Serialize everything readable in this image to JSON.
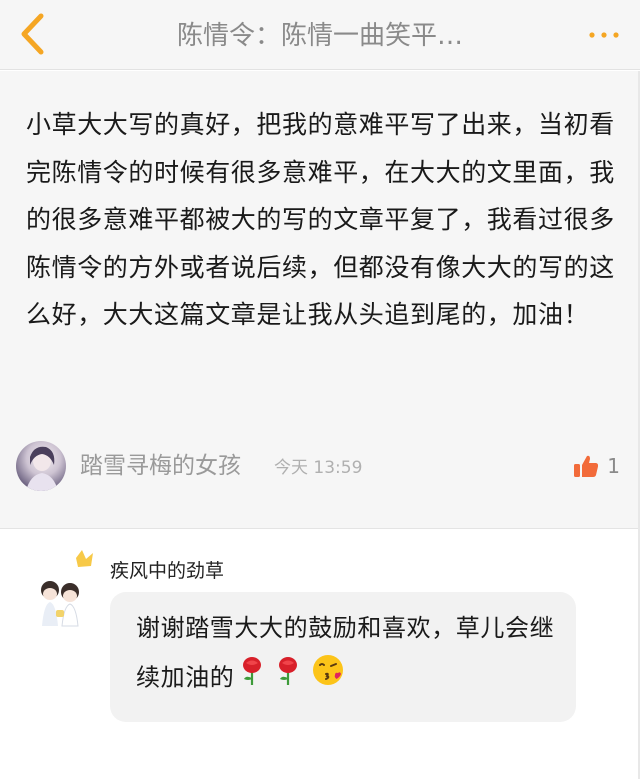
{
  "header": {
    "title": "陈情令：陈情一曲笑平…",
    "back_icon": "chevron-left-icon",
    "more_icon": "more-dots-icon",
    "accent_color": "#f5a623"
  },
  "comment": {
    "text": "小草大大写的真好，把我的意难平写了出来，当初看完陈情令的时候有很多意难平，在大大的文里面，我的很多意难平都被大的写的文章平复了，我看过很多陈情令的方外或者说后续，但都没有像大大的写的这么好，大大这篇文章是让我从头追到尾的，加油！",
    "username": "踏雪寻梅的女孩",
    "timestamp": "今天 13:59",
    "like_count": "1",
    "like_icon": "thumbs-up-icon",
    "like_color": "#f26b3a"
  },
  "reply": {
    "author": "疾风中的劲草",
    "text": "谢谢踏雪大大的鼓励和喜欢，草儿会继续加油的",
    "emojis": [
      "rose-icon",
      "rose-icon",
      "kissing-face-icon"
    ]
  }
}
